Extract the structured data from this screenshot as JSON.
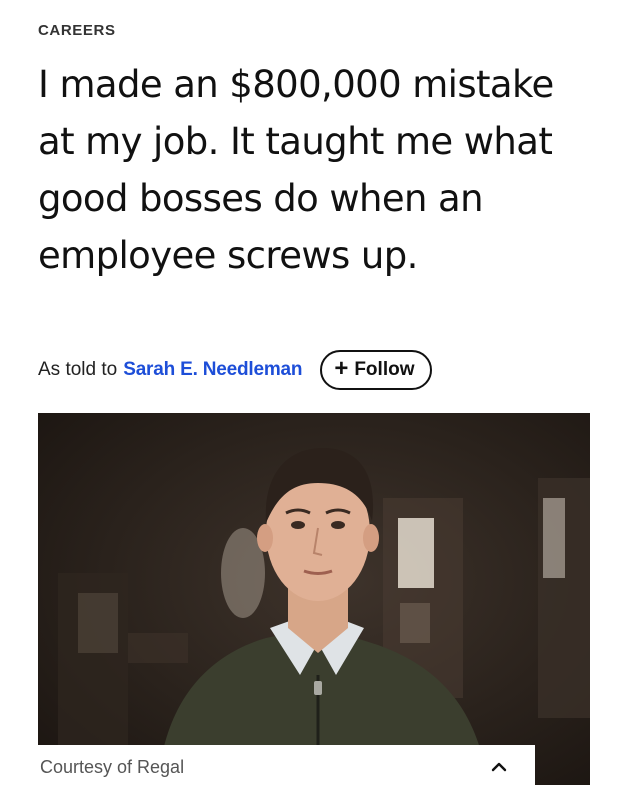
{
  "article": {
    "section": "CAREERS",
    "headline": "I made an $800,000 mistake at my job. It taught me what good bosses do when an employee screws up.",
    "byline": {
      "prefix": "As told to",
      "author": "Sarah E. Needleman",
      "follow_label": "Follow",
      "follow_icon": "plus-icon"
    },
    "image": {
      "caption": "Courtesy of Regal",
      "collapse_icon": "chevron-up-icon"
    }
  },
  "colors": {
    "author_link": "#1d4ed8",
    "text": "#111111",
    "caption": "#555555"
  }
}
